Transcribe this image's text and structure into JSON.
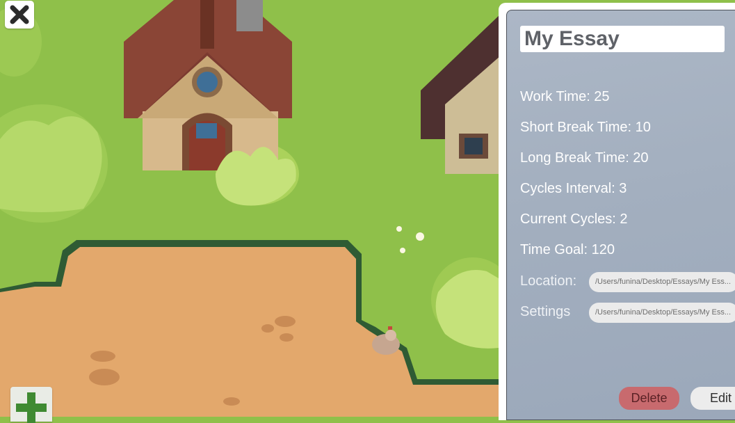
{
  "essay": {
    "title": "My Essay"
  },
  "stats": {
    "work_time": "Work Time: 25",
    "short_break": "Short Break Time: 10",
    "long_break": "Long Break Time: 20",
    "cycles_interval": "Cycles Interval: 3",
    "current_cycles": "Current Cycles: 2",
    "time_goal": "Time Goal: 120"
  },
  "location": {
    "label": "Location:",
    "path": "/Users/funina/Desktop/Essays/My Ess..."
  },
  "settings": {
    "label": "Settings",
    "path": "/Users/funina/Desktop/Essays/My Ess..."
  },
  "actions": {
    "delete_label": "Delete",
    "edit_label": "Edit"
  },
  "icons": {
    "close": "close-icon",
    "add": "plus-icon"
  },
  "colors": {
    "grass": "#8fc04a",
    "dirt": "#e3a86c",
    "panel": "#a3afbf",
    "delete": "#c86a6e",
    "plus": "#3f8a32"
  }
}
